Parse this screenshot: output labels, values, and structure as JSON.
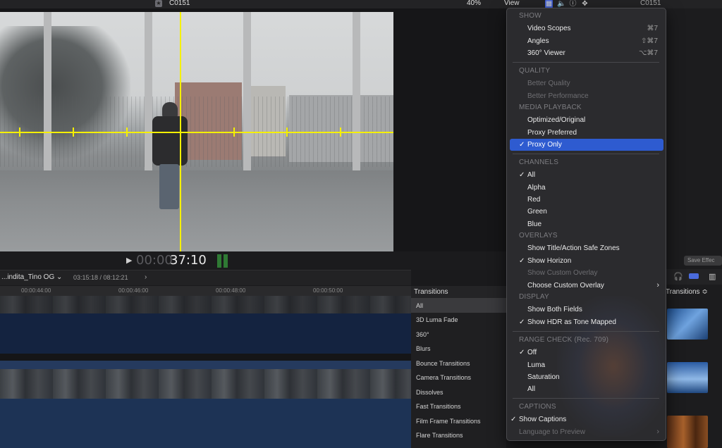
{
  "topbar": {
    "clip_title": "C0151",
    "zoom": "40%",
    "view_label": "View",
    "clip_title_right": "C0151"
  },
  "transport": {
    "timecode_dim": "00:00:",
    "timecode_bright": "37:10"
  },
  "timeline": {
    "project_name": "...indita_Tino OG",
    "project_time": "03:15:18 / 08:12:21",
    "ruler": [
      "00:00:44:00",
      "00:00:46:00",
      "00:00:48:00",
      "00:00:50:00"
    ]
  },
  "transitions_browser": {
    "title": "Transitions",
    "items": [
      "All",
      "3D Luma Fade",
      "360°",
      "Blurs",
      "Bounce Transitions",
      "Camera Transitions",
      "Dissolves",
      "Fast Transitions",
      "Film Frame Transitions",
      "Flare Transitions"
    ]
  },
  "right_panel": {
    "save_effects": "Save Effec",
    "transitions_label": "Transitions ≎"
  },
  "menu": {
    "sections": {
      "show": "SHOW",
      "quality": "QUALITY",
      "media_playback": "MEDIA PLAYBACK",
      "channels": "CHANNELS",
      "overlays": "OVERLAYS",
      "display": "DISPLAY",
      "range_check": "RANGE CHECK (Rec. 709)",
      "captions": "CAPTIONS"
    },
    "items": {
      "video_scopes": "Video Scopes",
      "video_scopes_sc": "⌘7",
      "angles": "Angles",
      "angles_sc": "⇧⌘7",
      "viewer_360": "360° Viewer",
      "viewer_360_sc": "⌥⌘7",
      "better_quality": "Better Quality",
      "better_performance": "Better Performance",
      "optimized_original": "Optimized/Original",
      "proxy_preferred": "Proxy Preferred",
      "proxy_only": "Proxy Only",
      "ch_all": "All",
      "alpha": "Alpha",
      "red": "Red",
      "green": "Green",
      "blue": "Blue",
      "safe_zones": "Show Title/Action Safe Zones",
      "show_horizon": "Show Horizon",
      "show_custom_overlay": "Show Custom Overlay",
      "choose_custom_overlay": "Choose Custom Overlay",
      "both_fields": "Show Both Fields",
      "hdr_tone_mapped": "Show HDR as Tone Mapped",
      "off": "Off",
      "luma": "Luma",
      "saturation": "Saturation",
      "rc_all": "All",
      "show_captions": "Show Captions",
      "language_preview": "Language to Preview"
    },
    "check": "✓",
    "submenu_arrow": "›"
  }
}
